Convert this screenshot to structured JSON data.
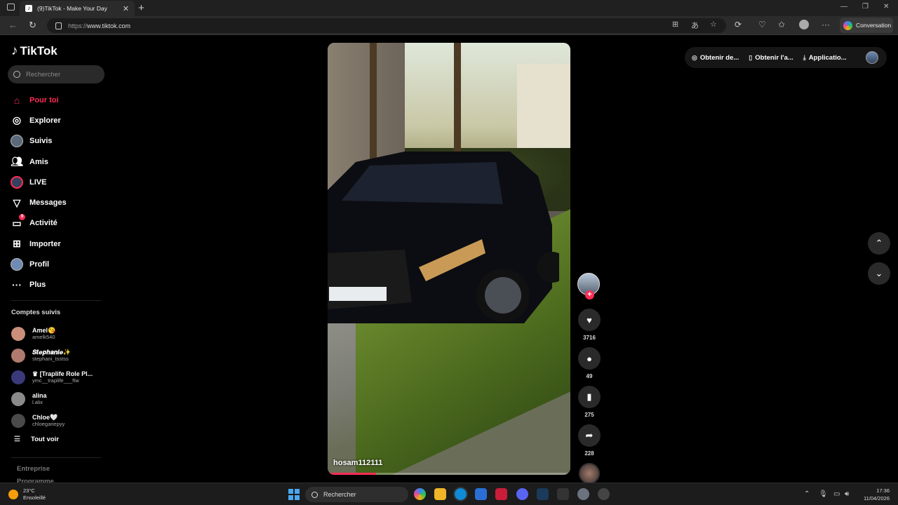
{
  "browser": {
    "tab_title": "(9)TikTok - Make Your Day",
    "tab_close": "✕",
    "new_tab": "+",
    "url_scheme": "https://",
    "url_host": "www.tiktok.com",
    "conversation_label": "Conversation",
    "more": "···"
  },
  "sidebar": {
    "logo_text": "TikTok",
    "search_placeholder": "Rechercher",
    "nav": [
      {
        "label": "Pour toi"
      },
      {
        "label": "Explorer"
      },
      {
        "label": "Suivis"
      },
      {
        "label": "Amis"
      },
      {
        "label": "LIVE"
      },
      {
        "label": "Messages"
      },
      {
        "label": "Activité",
        "badge": "9"
      },
      {
        "label": "Importer"
      },
      {
        "label": "Profil"
      },
      {
        "label": "Plus"
      }
    ],
    "followed_title": "Comptes suivis",
    "accounts": [
      {
        "name": "Amel😘",
        "handle": "amelk540",
        "color": "#c98f7a"
      },
      {
        "name": "𝑺𝒕𝒆𝒑𝒉𝒂𝒏𝒊𝒆✨",
        "handle": "stephani_tsstss",
        "color": "#b07a6e"
      },
      {
        "name": "♛ [Traplife Role Pl...",
        "handle": "ymc__traplife___ftw",
        "color": "#3a3a7a"
      },
      {
        "name": "alina",
        "handle": "l.alix",
        "color": "#8a8a8a"
      },
      {
        "name": "Chloe🤍",
        "handle": "chloegariepyy",
        "color": "#4a4a4a"
      }
    ],
    "see_all": "Tout voir",
    "footer": [
      "Entreprise",
      "Programme"
    ]
  },
  "video": {
    "author": "hosam112111",
    "progress": 0.2
  },
  "actions": {
    "likes": "3716",
    "comments": "49",
    "saves": "275",
    "shares": "228"
  },
  "topbar": {
    "get_coins": "Obtenir de...",
    "get_app": "Obtenir l'a...",
    "application": "Applicatio..."
  },
  "taskbar": {
    "temperature": "23°C",
    "weather": "Ensoleillé",
    "search": "Rechercher",
    "time": "17:36",
    "date": "11/04/2026"
  }
}
